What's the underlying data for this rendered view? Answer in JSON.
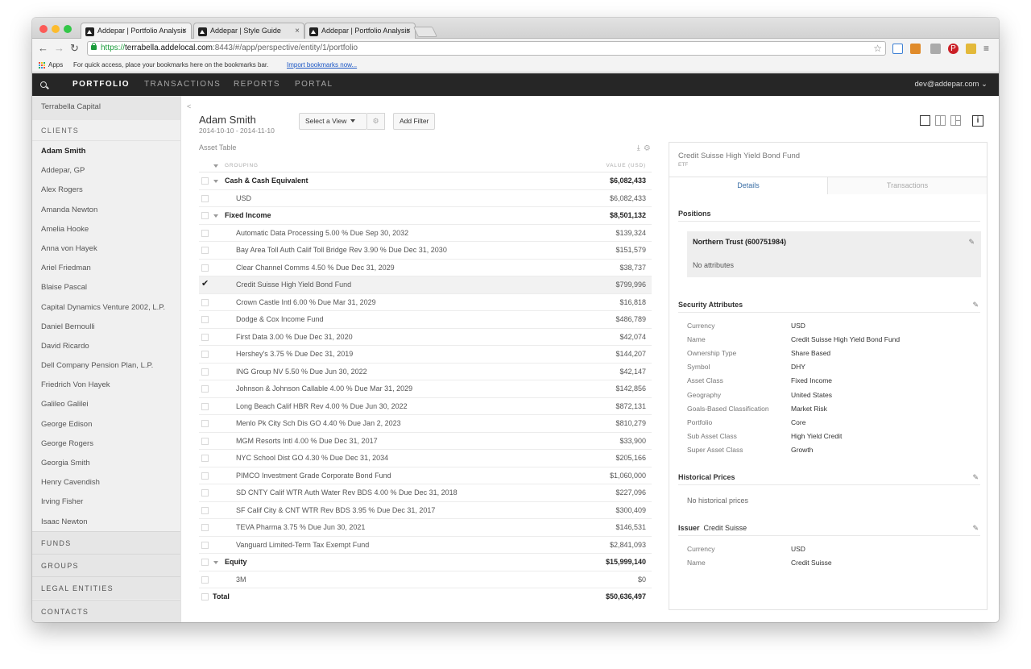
{
  "browser": {
    "tabs": [
      {
        "title": "Addepar | Portfolio Analysis"
      },
      {
        "title": "Addepar | Style Guide"
      },
      {
        "title": "Addepar | Portfolio Analysis"
      }
    ],
    "url_scheme": "https://",
    "url_host": "terrabella.addelocal.com",
    "url_path": ":8443/#/app/perspective/entity/1/portfolio",
    "bookmarks": {
      "apps": "Apps",
      "hint": "For quick access, place your bookmarks here on the bookmarks bar.",
      "import_link": "Import bookmarks now..."
    }
  },
  "topnav": {
    "items": [
      "PORTFOLIO",
      "TRANSACTIONS",
      "REPORTS",
      "PORTAL"
    ],
    "active": "PORTFOLIO",
    "user": "dev@addepar.com"
  },
  "sidebar": {
    "firm": "Terrabella Capital",
    "clients_header": "CLIENTS",
    "clients": [
      "Adam Smith",
      "Addepar, GP",
      "Alex Rogers",
      "Amanda Newton",
      "Amelia Hooke",
      "Anna von Hayek",
      "Ariel Friedman",
      "Blaise Pascal",
      "Capital Dynamics Venture 2002, L.P.",
      "Daniel Bernoulli",
      "David Ricardo",
      "Dell Company Pension Plan, L.P.",
      "Friedrich Von Hayek",
      "Galileo Galilei",
      "George Edison",
      "George Rogers",
      "Georgia Smith",
      "Henry Cavendish",
      "Irving Fisher",
      "Isaac Newton"
    ],
    "active_client": "Adam Smith",
    "sections": [
      "FUNDS",
      "GROUPS",
      "LEGAL ENTITIES",
      "CONTACTS"
    ]
  },
  "header": {
    "entity_name": "Adam Smith",
    "date_range": "2014-10-10  - 2014-11-10",
    "select_view": "Select a View",
    "add_filter": "Add Filter"
  },
  "table": {
    "title": "Asset Table",
    "col_grouping": "GROUPING",
    "col_value": "VALUE (USD)",
    "rows": [
      {
        "type": "group",
        "label": "Cash & Cash Equivalent",
        "value": "$6,082,433"
      },
      {
        "type": "item",
        "label": "USD",
        "value": "$6,082,433"
      },
      {
        "type": "group",
        "label": "Fixed Income",
        "value": "$8,501,132"
      },
      {
        "type": "item",
        "label": "Automatic Data Processing 5.00 % Due Sep 30, 2032",
        "value": "$139,324"
      },
      {
        "type": "item",
        "label": "Bay Area Toll Auth Calif Toll Bridge Rev 3.90 % Due Dec 31, 2030",
        "value": "$151,579"
      },
      {
        "type": "item",
        "label": "Clear Channel Comms 4.50 % Due Dec 31, 2029",
        "value": "$38,737"
      },
      {
        "type": "item",
        "label": "Credit Suisse High Yield Bond Fund",
        "value": "$799,996",
        "selected": true
      },
      {
        "type": "item",
        "label": "Crown Castle Intl 6.00 % Due Mar 31, 2029",
        "value": "$16,818"
      },
      {
        "type": "item",
        "label": "Dodge & Cox Income Fund",
        "value": "$486,789"
      },
      {
        "type": "item",
        "label": "First Data 3.00 % Due Dec 31, 2020",
        "value": "$42,074"
      },
      {
        "type": "item",
        "label": "Hershey's 3.75 % Due Dec 31, 2019",
        "value": "$144,207"
      },
      {
        "type": "item",
        "label": "ING Group NV 5.50 % Due Jun 30, 2022",
        "value": "$42,147"
      },
      {
        "type": "item",
        "label": "Johnson & Johnson Callable 4.00 % Due Mar 31, 2029",
        "value": "$142,856"
      },
      {
        "type": "item",
        "label": "Long Beach Calif HBR Rev 4.00 % Due Jun 30, 2022",
        "value": "$872,131"
      },
      {
        "type": "item",
        "label": "Menlo Pk City Sch Dis GO 4.40 % Due Jan 2, 2023",
        "value": "$810,279"
      },
      {
        "type": "item",
        "label": "MGM Resorts Intl 4.00 % Due Dec 31, 2017",
        "value": "$33,900"
      },
      {
        "type": "item",
        "label": "NYC School Dist GO 4.30 % Due Dec 31, 2034",
        "value": "$205,166"
      },
      {
        "type": "item",
        "label": "PIMCO Investment Grade Corporate Bond Fund",
        "value": "$1,060,000"
      },
      {
        "type": "item",
        "label": "SD CNTY Calif WTR Auth Water Rev BDS 4.00 % Due Dec 31, 2018",
        "value": "$227,096"
      },
      {
        "type": "item",
        "label": "SF Calif City & CNT WTR Rev BDS 3.95 % Due Dec 31, 2017",
        "value": "$300,409"
      },
      {
        "type": "item",
        "label": "TEVA Pharma 3.75 % Due Jun 30, 2021",
        "value": "$146,531"
      },
      {
        "type": "item",
        "label": "Vanguard Limited-Term Tax Exempt Fund",
        "value": "$2,841,093"
      },
      {
        "type": "group",
        "label": "Equity",
        "value": "$15,999,140"
      },
      {
        "type": "item",
        "label": "3M",
        "value": "$0"
      },
      {
        "type": "total",
        "label": "Total",
        "value": "$50,636,497"
      }
    ]
  },
  "detail": {
    "title": "Credit Suisse High Yield Bond Fund",
    "subtitle": "ETF",
    "tabs": [
      "Details",
      "Transactions"
    ],
    "active_tab": "Details",
    "positions_header": "Positions",
    "position_name": "Northern Trust (600751984)",
    "position_attrs": "No attributes",
    "security_header": "Security Attributes",
    "security_attributes": [
      {
        "k": "Currency",
        "v": "USD"
      },
      {
        "k": "Name",
        "v": "Credit Suisse High Yield Bond Fund"
      },
      {
        "k": "Ownership Type",
        "v": "Share Based"
      },
      {
        "k": "Symbol",
        "v": "DHY"
      },
      {
        "k": "Asset Class",
        "v": "Fixed Income"
      },
      {
        "k": "Geography",
        "v": "United States"
      },
      {
        "k": "Goals-Based Classification",
        "v": "Market Risk"
      },
      {
        "k": "Portfolio",
        "v": "Core"
      },
      {
        "k": "Sub Asset Class",
        "v": "High Yield Credit"
      },
      {
        "k": "Super Asset Class",
        "v": "Growth"
      }
    ],
    "historical_header": "Historical Prices",
    "historical_empty": "No historical prices",
    "issuer_label": "Issuer",
    "issuer_name": "Credit Suisse",
    "issuer_attributes": [
      {
        "k": "Currency",
        "v": "USD"
      },
      {
        "k": "Name",
        "v": "Credit Suisse"
      }
    ]
  },
  "colors": {
    "topnav_bg": "#262626",
    "accent": "#3a6ea5",
    "sidebar_bg": "#f0f0f0"
  }
}
